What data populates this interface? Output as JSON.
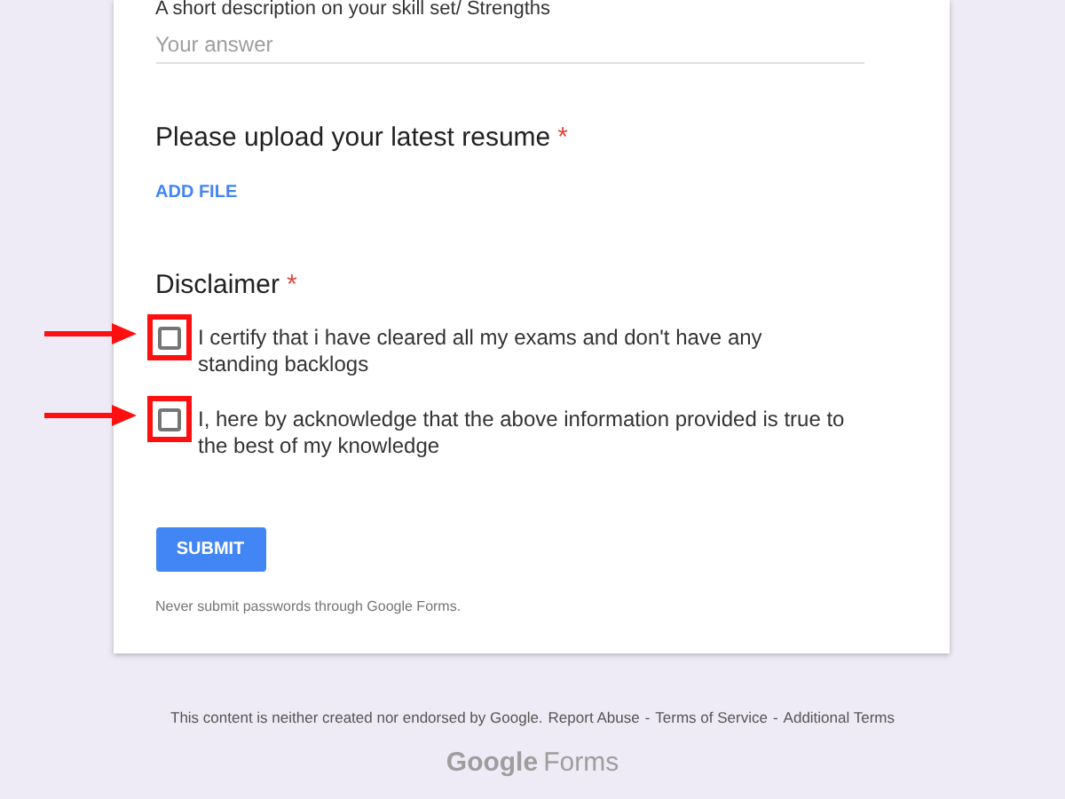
{
  "form": {
    "description": {
      "label": "A short description on your skill set/ Strengths",
      "placeholder": "Your answer"
    },
    "upload": {
      "title": "Please upload your latest resume",
      "required_mark": "*",
      "button": "ADD FILE"
    },
    "disclaimer": {
      "title": "Disclaimer",
      "required_mark": "*",
      "options": [
        {
          "label": "I certify that i have cleared all my exams and don't have any standing backlogs",
          "checked": false,
          "highlighted": true
        },
        {
          "label": "I, here by acknowledge that the above information provided is true to the best of my knowledge",
          "checked": false,
          "highlighted": true
        }
      ]
    },
    "submit": "SUBMIT",
    "note": "Never submit passwords through Google Forms."
  },
  "footer": {
    "text": "This content is neither created nor endorsed by Google.",
    "links": [
      "Report Abuse",
      "Terms of Service",
      "Additional Terms"
    ],
    "separator": "-",
    "logo": {
      "brand": "Google",
      "product": "Forms"
    }
  }
}
